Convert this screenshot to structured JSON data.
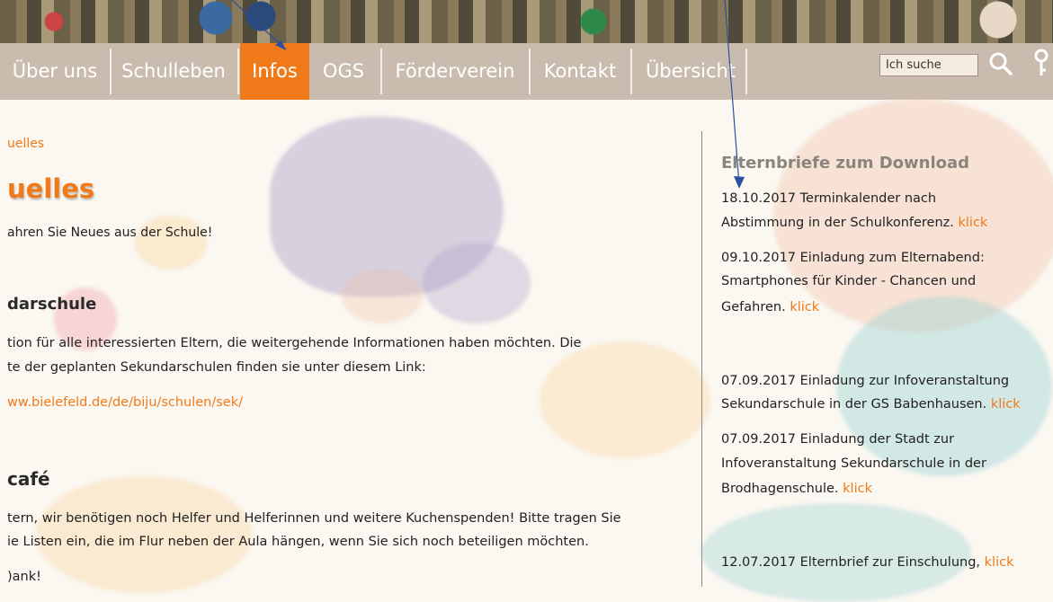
{
  "nav": {
    "items": [
      {
        "label": "Über uns"
      },
      {
        "label": "Schulleben"
      },
      {
        "label": "Infos"
      },
      {
        "label": "OGS"
      },
      {
        "label": "Förderverein"
      },
      {
        "label": "Kontakt"
      },
      {
        "label": "Übersicht"
      }
    ],
    "active": "Infos"
  },
  "search": {
    "value": "Ich suche"
  },
  "icons": {
    "search": "search-icon",
    "key": "key-icon"
  },
  "colors": {
    "accent": "#f07a1a",
    "nav_bg": "#c9bcae"
  },
  "main": {
    "breadcrumb": "uelles",
    "title": "uelles",
    "intro": "ahren Sie Neues aus der Schule!",
    "sections": [
      {
        "heading": "darschule",
        "lines": [
          "tion für alle interessierten Eltern, die weitergehende Informationen haben möchten.  Die",
          "te der geplanten Sekundarschulen finden sie unter diesem Link:"
        ],
        "link": "ww.bielefeld.de/de/biju/schulen/sek/"
      },
      {
        "heading": "café",
        "lines": [
          "tern, wir benötigen noch Helfer und Helferinnen und weitere Kuchenspenden! Bitte tragen Sie",
          "ie Listen ein, die im Flur neben der Aula hängen, wenn Sie sich noch beteiligen möchten."
        ],
        "closing": ")ank!"
      }
    ]
  },
  "sidebar": {
    "title": "Elternbriefe zum Download",
    "klick": "klick",
    "entries": [
      {
        "line1": "18.10.2017 Terminkalender nach",
        "line2": "Abstimmung in der Schulkonferenz."
      },
      {
        "line1": "09.10.2017 Einladung zum Elternabend:",
        "line2": "Smartphones für Kinder - Chancen und",
        "line3": "Gefahren."
      },
      {
        "line1": "07.09.2017 Einladung zur Infoveranstaltung",
        "line2": "Sekundarschule in der GS Babenhausen."
      },
      {
        "line1": "07.09.2017 Einladung der Stadt zur",
        "line2": "Infoveranstaltung Sekundarschule in der",
        "line3": "Brodhagenschule."
      },
      {
        "line1": "12.07.2017 Elternbrief zur Einschulung,"
      }
    ]
  }
}
